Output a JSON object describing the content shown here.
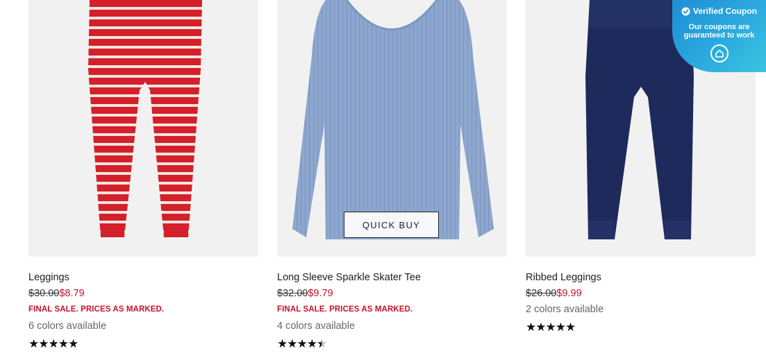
{
  "products": [
    {
      "title": "Leggings",
      "original_price": "$30.00",
      "sale_price": "$8.79",
      "final_sale": "FINAL SALE. PRICES AS MARKED.",
      "colors": "6 colors available",
      "rating": 5,
      "image": "red-white-striped-leggings"
    },
    {
      "title": "Long Sleeve Sparkle Skater Tee",
      "original_price": "$32.00",
      "sale_price": "$9.79",
      "final_sale": "FINAL SALE. PRICES AS MARKED.",
      "colors": "4 colors available",
      "rating": 4.5,
      "image": "light-blue-ribbed-long-sleeve-tee"
    },
    {
      "title": "Ribbed Leggings",
      "original_price": "$26.00",
      "sale_price": "$9.99",
      "colors": "2 colors available",
      "rating": 5,
      "image": "navy-ribbed-leggings"
    }
  ],
  "quick_buy_label": "QUICK BUY",
  "coupon": {
    "title": "Verified Coupon",
    "subtitle_line1": "Our coupons are",
    "subtitle_line2": "guaranteed to work",
    "check_icon": "check-circle-icon",
    "logo_icon": "home-logo-icon"
  },
  "colors": {
    "sale_red": "#c8102e",
    "badge_blue": "#2aa7df",
    "legging_red": "#d4202a",
    "tee_blue": "#8ea7cf",
    "navy": "#1f2a5c",
    "image_bg": "#f1f1f1"
  }
}
